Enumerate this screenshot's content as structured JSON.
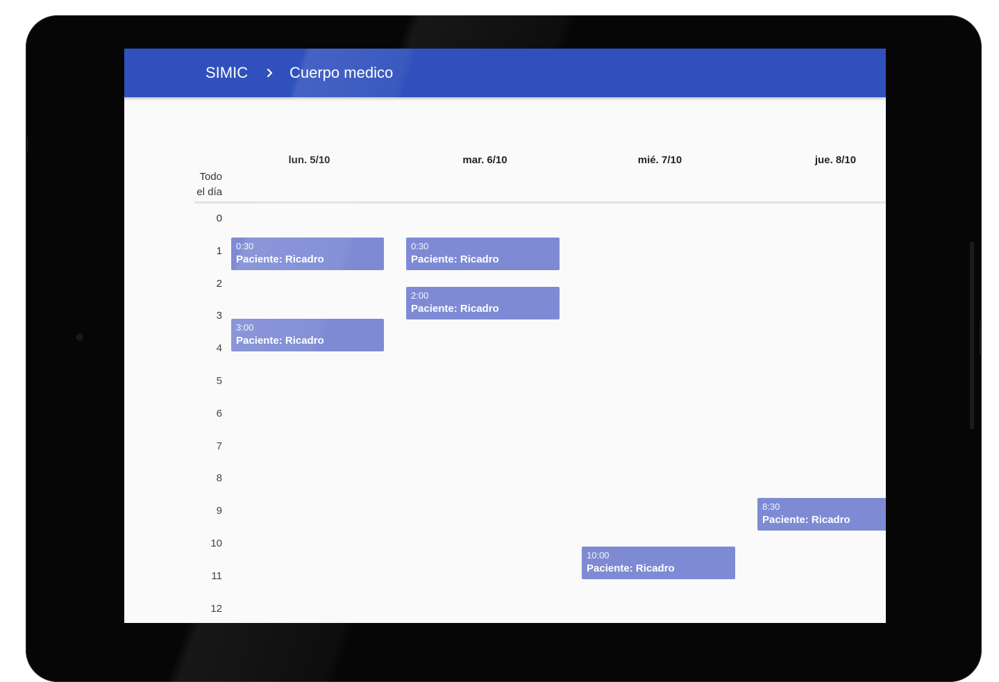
{
  "header": {
    "app_title": "SIMIC",
    "separator_icon": "chevron-right-icon",
    "section_title": "Cuerpo medico"
  },
  "colors": {
    "app_bar": "#3051bd",
    "event": "#7e8bd4",
    "background": "#fafafa",
    "device_frame": "#060606"
  },
  "calendar": {
    "all_day_label_line1": "Todo",
    "all_day_label_line2": "el día",
    "days": [
      {
        "label": "lun. 5/10"
      },
      {
        "label": "mar. 6/10"
      },
      {
        "label": "mié. 7/10"
      },
      {
        "label": "jue. 8/10"
      }
    ],
    "hours": [
      "0",
      "1",
      "2",
      "3",
      "4",
      "5",
      "6",
      "7",
      "8",
      "9",
      "10",
      "11",
      "12"
    ],
    "events": [
      {
        "day": 0,
        "start_hour": 0.5,
        "time": "0:30",
        "title": "Paciente: Ricadro"
      },
      {
        "day": 0,
        "start_hour": 3.0,
        "time": "3:00",
        "title": "Paciente: Ricadro"
      },
      {
        "day": 1,
        "start_hour": 0.5,
        "time": "0:30",
        "title": "Paciente: Ricadro"
      },
      {
        "day": 1,
        "start_hour": 2.0,
        "time": "2:00",
        "title": "Paciente: Ricadro"
      },
      {
        "day": 2,
        "start_hour": 10.0,
        "time": "10:00",
        "title": "Paciente: Ricadro"
      },
      {
        "day": 3,
        "start_hour": 8.5,
        "time": "8:30",
        "title": "Paciente: Ricadro"
      }
    ]
  }
}
